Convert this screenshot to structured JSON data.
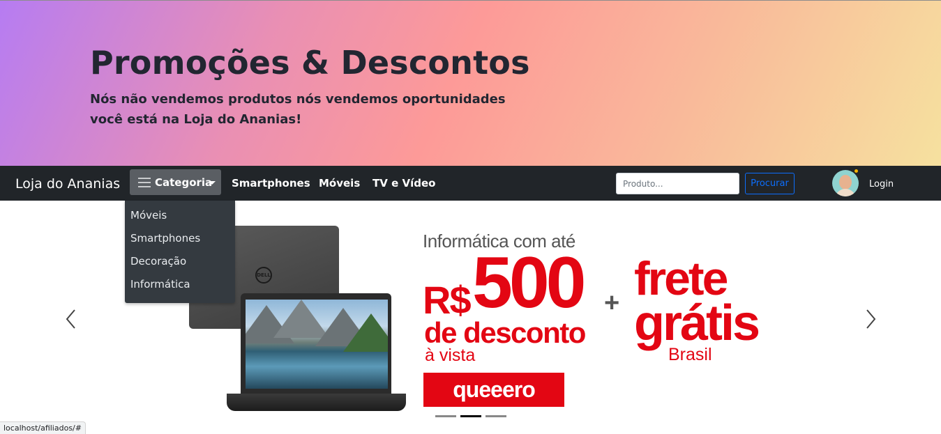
{
  "hero": {
    "title": "Promoções & Descontos",
    "subtitle_line1": "Nós não vendemos produtos nós vendemos oportunidades",
    "subtitle_line2": "você está na Loja do Ananias!"
  },
  "navbar": {
    "brand": "Loja do Ananias",
    "category_label": "Categoria",
    "links": [
      "Smartphones",
      "Móveis",
      "TV e Vídeo"
    ],
    "search": {
      "placeholder": "Produto...",
      "value": "",
      "button_label": "Procurar"
    },
    "login_label": "Login"
  },
  "dropdown": {
    "items": [
      "Móveis",
      "Smartphones",
      "Decoração",
      "Informática"
    ]
  },
  "carousel": {
    "slide": {
      "line1": "Informática com até",
      "currency": "R$",
      "amount": "500",
      "discount_label": "de desconto",
      "payment_label": "à vista",
      "plus": "+",
      "frete": "frete",
      "gratis": "grátis",
      "region": "Brasil",
      "cta_label": "queeero",
      "laptop_brand": "DELL"
    },
    "indicators_count": 3,
    "active_index": 1
  },
  "statusbar": {
    "url": "localhost/afiliados/#"
  },
  "colors": {
    "accent_red": "#e30613",
    "navbar_bg": "#212529",
    "link_blue": "#0d6efd"
  }
}
